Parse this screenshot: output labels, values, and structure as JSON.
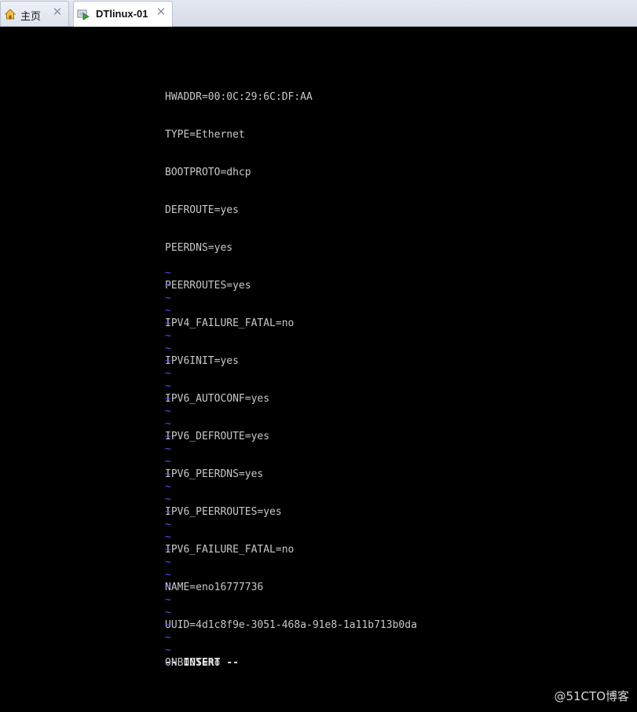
{
  "tabs": [
    {
      "label": "主页",
      "icon": "home-icon",
      "active": false
    },
    {
      "label": "DTlinux-01",
      "icon": "vm-icon",
      "active": true
    }
  ],
  "close_glyph": "✕",
  "terminal": {
    "lines": [
      "HWADDR=00:0C:29:6C:DF:AA",
      "TYPE=Ethernet",
      "BOOTPROTO=dhcp",
      "DEFROUTE=yes",
      "PEERDNS=yes",
      "PEERROUTES=yes",
      "IPV4_FAILURE_FATAL=no",
      "IPV6INIT=yes",
      "IPV6_AUTOCONF=yes",
      "IPV6_DEFROUTE=yes",
      "IPV6_PEERDNS=yes",
      "IPV6_PEERROUTES=yes",
      "IPV6_FAILURE_FATAL=no",
      "NAME=eno16777736",
      "UUID=4d1c8f9e-3051-468a-91e8-1a11b713b0da",
      "ONBOOT=no"
    ],
    "tildes": [
      "~",
      "~",
      "~",
      "~",
      "~",
      "~",
      "~",
      "~",
      "~",
      "~",
      "~",
      "~",
      "~",
      "~",
      "~",
      "~",
      "~",
      "~",
      "~",
      "~",
      "~",
      "~",
      "~",
      "~",
      "~",
      "~",
      "~",
      "~",
      "~",
      "~",
      "~",
      "~"
    ],
    "mode": "-- INSERT --"
  },
  "watermark": "@51CTO博客",
  "colors": {
    "background": "#000000",
    "text": "#c8c8c8",
    "tilde": "#5555ff"
  }
}
